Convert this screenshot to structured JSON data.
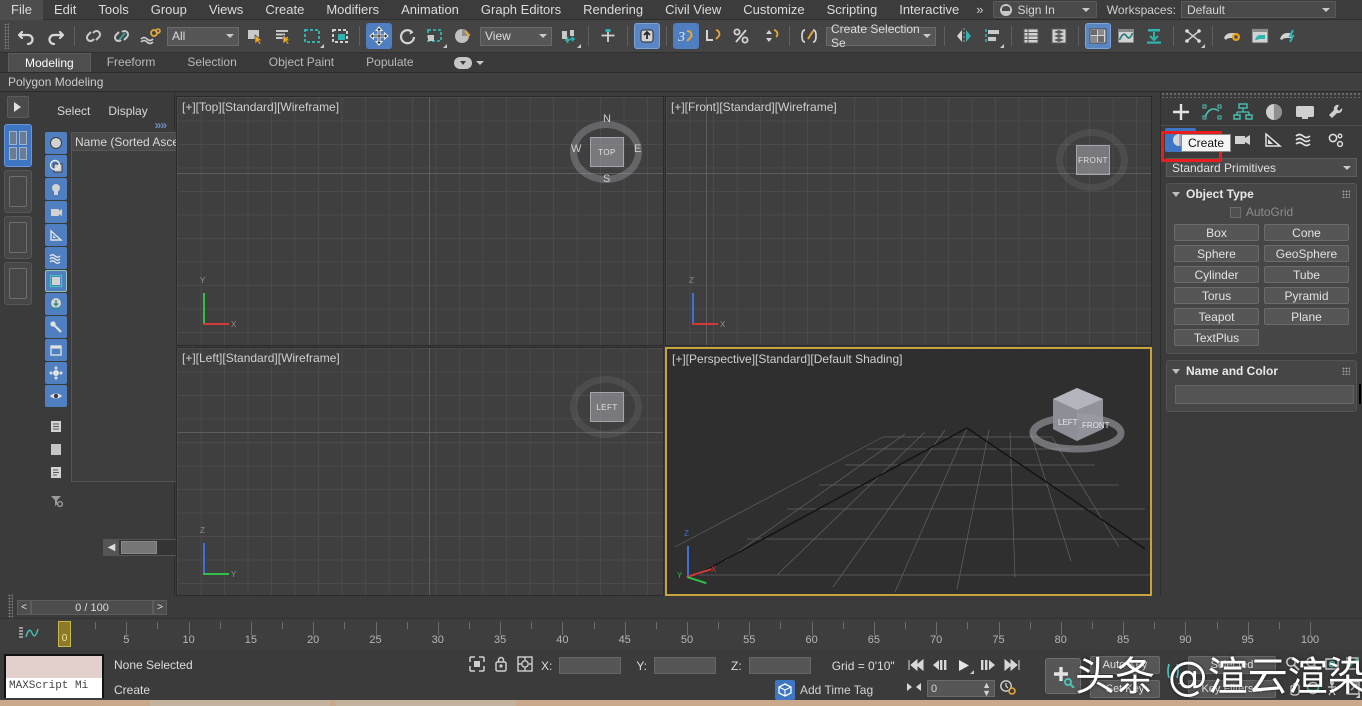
{
  "menu": {
    "items": [
      "File",
      "Edit",
      "Tools",
      "Group",
      "Views",
      "Create",
      "Modifiers",
      "Animation",
      "Graph Editors",
      "Rendering",
      "Civil View",
      "Customize",
      "Scripting",
      "Interactive"
    ],
    "overflow": "»",
    "sign_in": "Sign In",
    "workspaces_label": "Workspaces:",
    "workspace_value": "Default"
  },
  "toolbar": {
    "selection_filter": "All",
    "reference_coord": "View",
    "selection_set": "Create Selection Se"
  },
  "ribbon": {
    "tabs": [
      "Modeling",
      "Freeform",
      "Selection",
      "Object Paint",
      "Populate"
    ],
    "selected_tab": "Modeling",
    "subtab": "Polygon Modeling"
  },
  "explorer": {
    "tabs": [
      "Select",
      "Display"
    ],
    "expand": "»»",
    "column_header": "Name (Sorted Ascend"
  },
  "viewports": [
    {
      "label": "[+][Top][Standard][Wireframe]",
      "type": "ortho",
      "cube": "TOP"
    },
    {
      "label": "[+][Front][Standard][Wireframe]",
      "type": "ortho",
      "cube": "FRONT"
    },
    {
      "label": "[+][Left][Standard][Wireframe]",
      "type": "ortho",
      "cube": "LEFT"
    },
    {
      "label": "[+][Perspective][Standard][Default Shading]",
      "type": "persp",
      "cube": "FRONT"
    }
  ],
  "viewcube": {
    "north": "N",
    "south": "S",
    "east": "E",
    "west": "W"
  },
  "command_panel": {
    "category_dropdown": "Standard Primitives",
    "tooltip": "Create",
    "object_type": {
      "title": "Object Type",
      "autogrid_label": "AutoGrid",
      "buttons": [
        "Box",
        "Cone",
        "Sphere",
        "GeoSphere",
        "Cylinder",
        "Tube",
        "Torus",
        "Pyramid",
        "Teapot",
        "Plane",
        "TextPlus"
      ]
    },
    "name_and_color": {
      "title": "Name and Color",
      "name_value": "",
      "color": "#c62a7c"
    }
  },
  "timeline": {
    "frame_readout": "0 / 100",
    "prev_label": "<",
    "next_label": ">",
    "ticks": [
      "0",
      "5",
      "10",
      "15",
      "20",
      "25",
      "30",
      "35",
      "40",
      "45",
      "50",
      "55",
      "60",
      "65",
      "70",
      "75",
      "80",
      "85",
      "90",
      "95",
      "100"
    ],
    "current_frame": "0"
  },
  "status": {
    "mini_listener": "MAXScript Mi",
    "selection_status": "None Selected",
    "prompt": "Create",
    "x_label": "X:",
    "y_label": "Y:",
    "z_label": "Z:",
    "x_value": "",
    "y_value": "",
    "z_value": "",
    "grid": "Grid = 0'10\"",
    "add_time_tag": "Add Time Tag",
    "set_key": "Set Key",
    "key_filters": "Key Filters...",
    "auto_key": "Auto Key",
    "selected_label": "Selected",
    "frame_field": "0"
  },
  "watermark": "头条 @渲云渲染",
  "colors": {
    "accent_blue": "#3e76c4",
    "highlight_red": "#e81d1d",
    "active_viewport": "#c8a23c",
    "object_color": "#c62a7c"
  }
}
